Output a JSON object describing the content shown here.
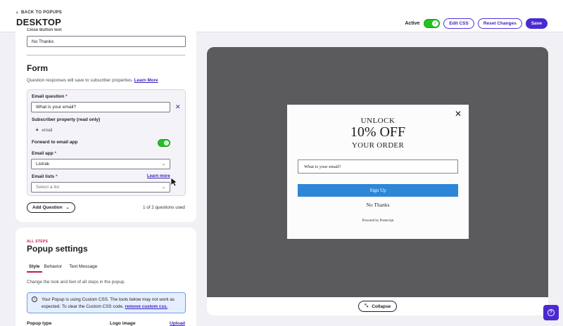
{
  "header": {
    "back_label": "BACK TO POPUPS",
    "title": "DESKTOP",
    "active_label": "Active",
    "active_on": true,
    "edit_css": "Edit CSS",
    "reset": "Reset Changes",
    "save": "Save"
  },
  "form_card": {
    "close_button_value": "No Thanks",
    "close_button_label_partial": "Close Button text",
    "title": "Form",
    "subtitle": "Question responses will save to subscriber properties.",
    "learn_more": "Learn More",
    "question": {
      "email_question_label": "Email question",
      "email_question_value": "What is your email?",
      "subscriber_property_label": "Subscriber property (read only)",
      "subscriber_property_value": "email",
      "forward_label": "Forward to email app",
      "forward_on": true,
      "email_app_label": "Email app",
      "email_app_value": "Listrak",
      "email_lists_label": "Email lists",
      "email_lists_link": "Learn more",
      "email_lists_placeholder": "Select a list"
    },
    "add_question": "Add Question",
    "questions_count": "1 of 2 questions used"
  },
  "settings_card": {
    "eyebrow": "ALL STEPS",
    "title": "Popup settings",
    "tabs": [
      "Style",
      "Behavior",
      "Text Message"
    ],
    "active_tab": "Style",
    "description": "Change the look and feel of all steps in the popup.",
    "info_line1": "Your Popup is using Custom CSS. The tools below may not work as",
    "info_line2": "expected. To clear the Custom CSS code,",
    "info_link": "remove custom css.",
    "popup_type_label": "Popup type",
    "logo_image_label": "Logo image",
    "upload_link": "Upload"
  },
  "preview": {
    "line1": "UNLOCK",
    "line2": "10% OFF",
    "line3": "YOUR ORDER",
    "input_placeholder": "What is your email?",
    "signup": "Sign Up",
    "no_thanks": "No Thanks",
    "powered_by": "Powered by Postscript",
    "collapse": "Collapse"
  },
  "colors": {
    "accent": "#4b2ad1",
    "toggle_on": "#21c221",
    "signup_blue": "#2d86d6",
    "eyebrow_pink": "#c2185b",
    "preview_bg": "#5b5a5c"
  }
}
